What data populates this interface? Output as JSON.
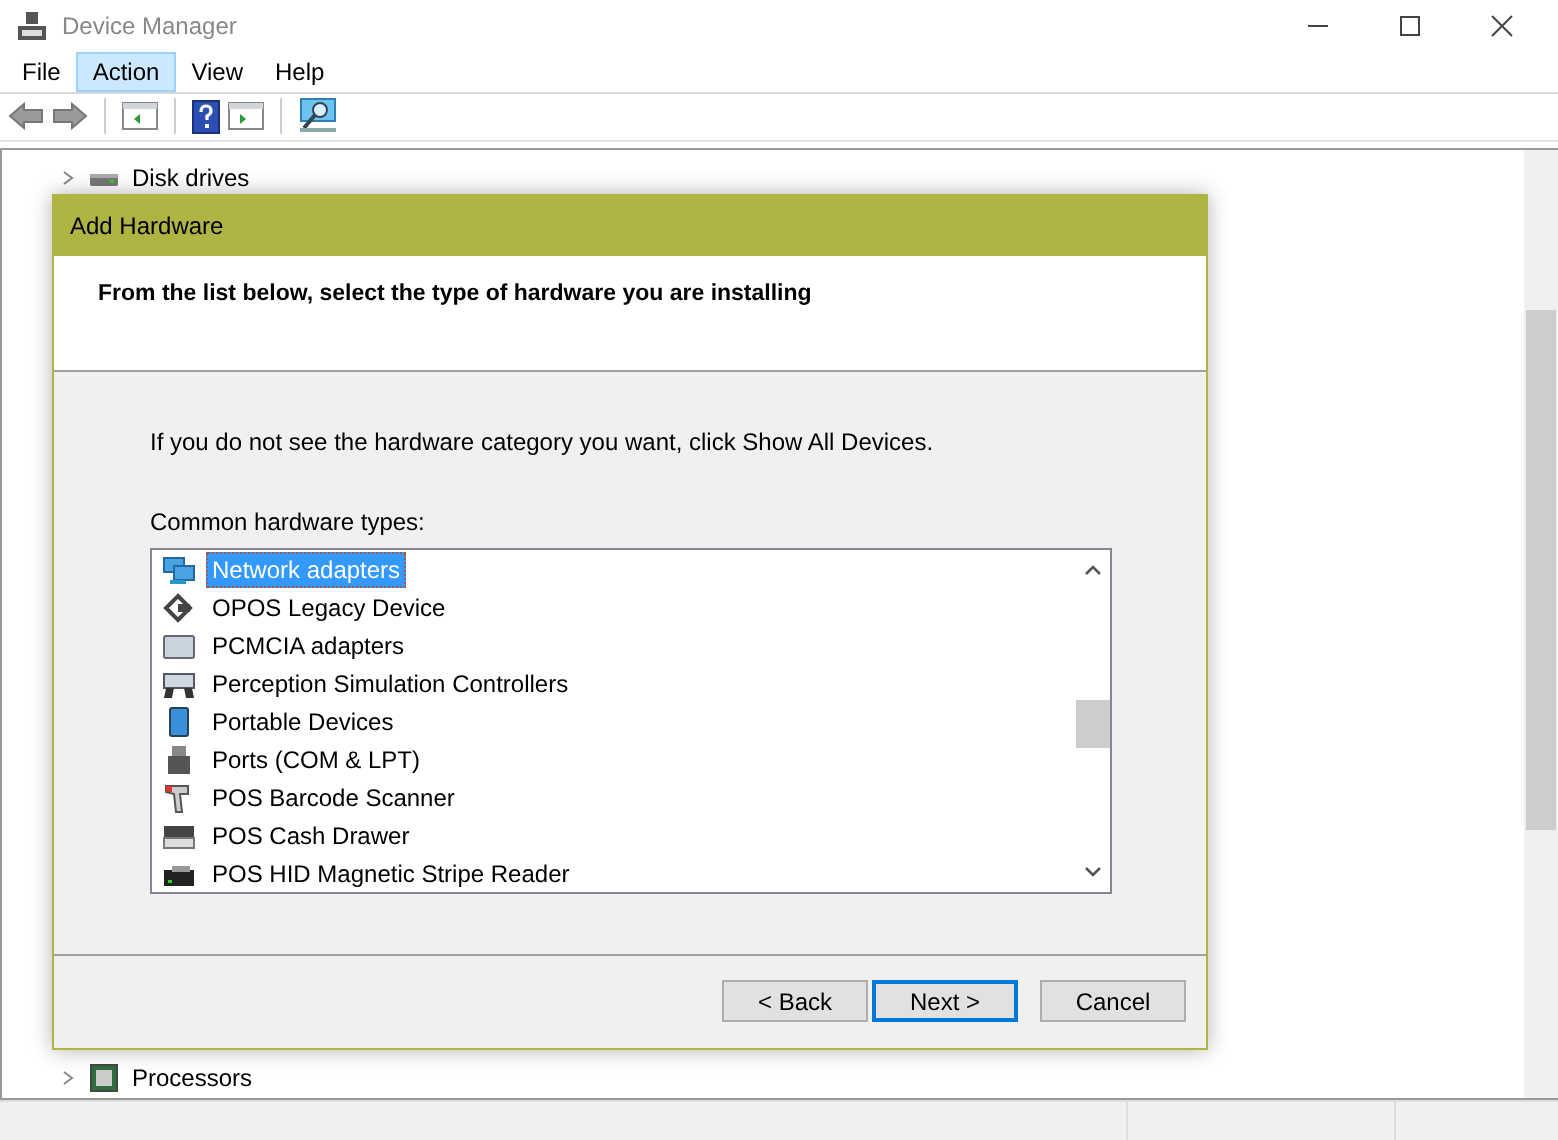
{
  "window": {
    "title": "Device Manager"
  },
  "menu": [
    {
      "label": "File",
      "selected": false
    },
    {
      "label": "Action",
      "selected": true
    },
    {
      "label": "View",
      "selected": false
    },
    {
      "label": "Help",
      "selected": false
    }
  ],
  "tree": {
    "items": [
      {
        "label": "Disk drives",
        "expanded": false
      },
      {
        "label": "Processors",
        "expanded": false
      }
    ]
  },
  "dialog": {
    "title": "Add Hardware",
    "heading": "From the list below, select the type of hardware you are installing",
    "hint": "If you do not see the hardware category you want, click Show All Devices.",
    "list_label": "Common hardware types:",
    "items": [
      {
        "label": "Network adapters",
        "selected": true
      },
      {
        "label": "OPOS Legacy Device",
        "selected": false
      },
      {
        "label": "PCMCIA adapters",
        "selected": false
      },
      {
        "label": "Perception Simulation Controllers",
        "selected": false
      },
      {
        "label": "Portable Devices",
        "selected": false
      },
      {
        "label": "Ports (COM & LPT)",
        "selected": false
      },
      {
        "label": "POS Barcode Scanner",
        "selected": false
      },
      {
        "label": "POS Cash Drawer",
        "selected": false
      },
      {
        "label": "POS HID Magnetic Stripe Reader",
        "selected": false
      }
    ],
    "buttons": [
      {
        "label": "< Back",
        "default": false
      },
      {
        "label": "Next >",
        "default": true
      },
      {
        "label": "Cancel",
        "default": false
      }
    ]
  }
}
